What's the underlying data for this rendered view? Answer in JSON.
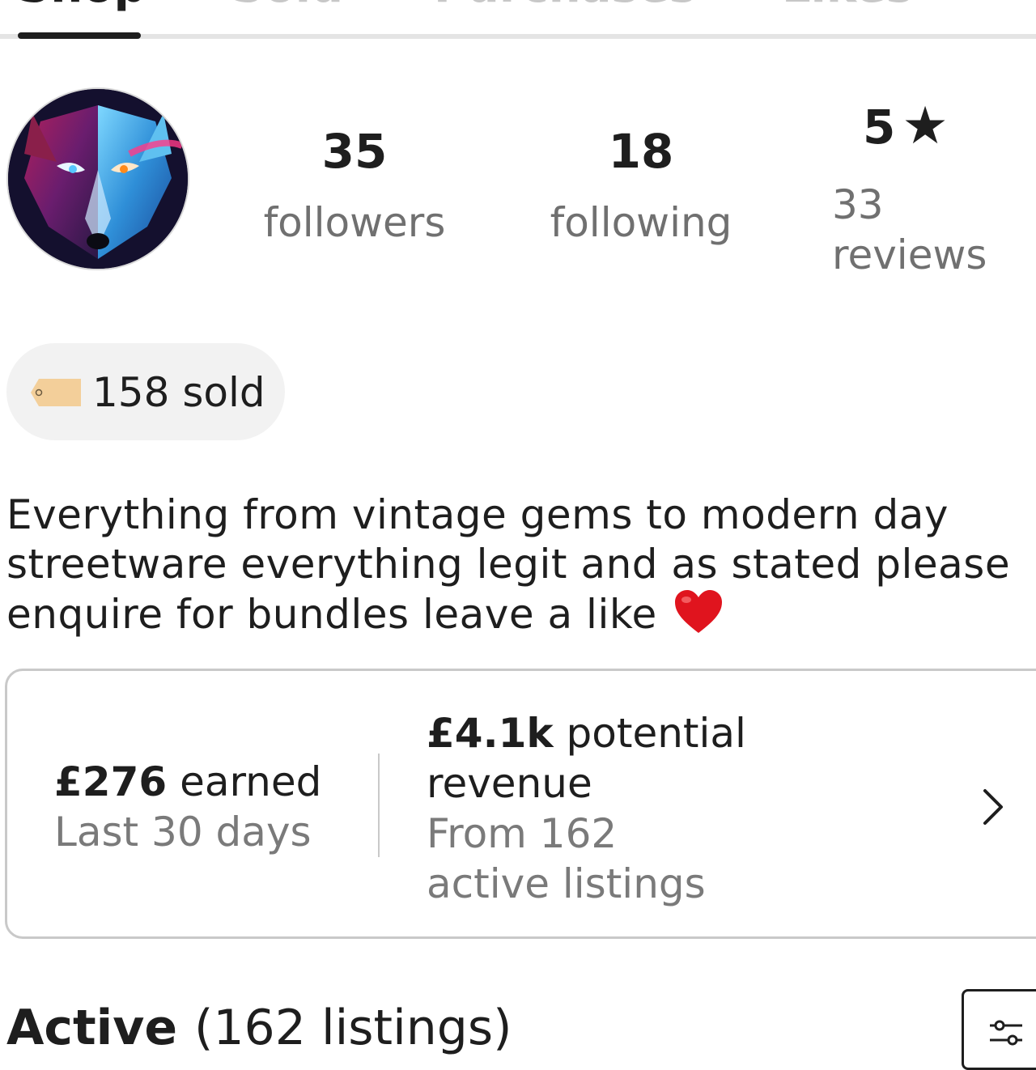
{
  "tabs": [
    {
      "label": "Shop",
      "active": true
    },
    {
      "label": "Sold",
      "active": false
    },
    {
      "label": "Purchases",
      "active": false
    },
    {
      "label": "Likes",
      "active": false
    }
  ],
  "profile": {
    "avatar_icon": "wolf-avatar-icon",
    "followers_count": "35",
    "followers_label": "followers",
    "following_count": "18",
    "following_label": "following",
    "rating_value": "5",
    "rating_icon": "star-icon",
    "reviews_count": "33",
    "reviews_label": "reviews"
  },
  "sold_badge": {
    "icon": "price-tag-icon",
    "label": "158 sold"
  },
  "bio": {
    "line1": "Everything from vintage gems to modern day",
    "line2": "streetware everything legit and as stated please",
    "line3": "enquire for bundles leave a like",
    "emoji": "heart-emoji"
  },
  "earnings": {
    "earned_amount": "£276",
    "earned_label": "earned",
    "earned_period": "Last 30 days",
    "potential_amount": "£4.1k",
    "potential_label_1": "potential",
    "potential_label_2": "revenue",
    "potential_source_1": "From 162",
    "potential_source_2": "active listings",
    "chevron_icon": "chevron-right-icon"
  },
  "active_section": {
    "title": "Active",
    "count": "(162 listings)",
    "filter_icon": "filter-sliders-icon"
  },
  "colors": {
    "text": "#1e1e1e",
    "muted": "#707070",
    "tab_inactive": "#c7c7c7",
    "pill_bg": "#f2f2f2",
    "border": "#c9c9c9",
    "heart": "#e0141e"
  }
}
